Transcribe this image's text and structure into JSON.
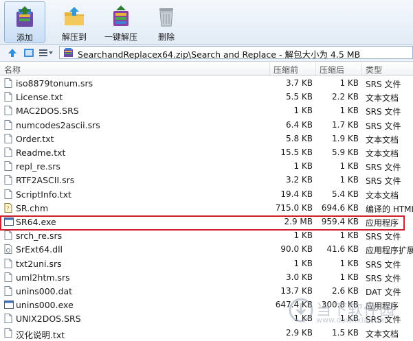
{
  "toolbar": {
    "add": "添加",
    "extract_to": "解压到",
    "one_click_extract": "一键解压",
    "delete": "删除"
  },
  "address": {
    "path": "SearchandReplacex64.zip\\Search and Replace - 解包大小为 4.5 MB"
  },
  "columns": {
    "name": "名称",
    "original_size": "压缩前",
    "compressed_size": "压缩后",
    "type": "类型"
  },
  "files": [
    {
      "name": "iso8879tonum.srs",
      "original": "3.7 KB",
      "compressed": "1 KB",
      "type": "SRS 文件"
    },
    {
      "name": "License.txt",
      "original": "5.5 KB",
      "compressed": "2.2 KB",
      "type": "文本文档"
    },
    {
      "name": "MAC2DOS.SRS",
      "original": "1 KB",
      "compressed": "1 KB",
      "type": "SRS 文件"
    },
    {
      "name": "numcodes2ascii.srs",
      "original": "6.4 KB",
      "compressed": "1.7 KB",
      "type": "SRS 文件"
    },
    {
      "name": "Order.txt",
      "original": "5.8 KB",
      "compressed": "1.9 KB",
      "type": "文本文档"
    },
    {
      "name": "Readme.txt",
      "original": "15.5 KB",
      "compressed": "5.9 KB",
      "type": "文本文档"
    },
    {
      "name": "repl_re.srs",
      "original": "1 KB",
      "compressed": "1 KB",
      "type": "SRS 文件"
    },
    {
      "name": "RTF2ASCII.srs",
      "original": "3.2 KB",
      "compressed": "1 KB",
      "type": "SRS 文件"
    },
    {
      "name": "ScriptInfo.txt",
      "original": "19.4 KB",
      "compressed": "5.4 KB",
      "type": "文本文档"
    },
    {
      "name": "SR.chm",
      "original": "715.0 KB",
      "compressed": "694.6 KB",
      "type": "编译的 HTML"
    },
    {
      "name": "SR64.exe",
      "original": "2.9 MB",
      "compressed": "959.4 KB",
      "type": "应用程序"
    },
    {
      "name": "srch_re.srs",
      "original": "1 KB",
      "compressed": "1 KB",
      "type": "SRS 文件"
    },
    {
      "name": "SrExt64.dll",
      "original": "90.0 KB",
      "compressed": "41.6 KB",
      "type": "应用程序扩展"
    },
    {
      "name": "txt2uni.srs",
      "original": "1 KB",
      "compressed": "1 KB",
      "type": "SRS 文件"
    },
    {
      "name": "uml2htm.srs",
      "original": "3.0 KB",
      "compressed": "1 KB",
      "type": "SRS 文件"
    },
    {
      "name": "unins000.dat",
      "original": "13.7 KB",
      "compressed": "2.6 KB",
      "type": "DAT 文件"
    },
    {
      "name": "unins000.exe",
      "original": "647.4 KB",
      "compressed": "300.8 KB",
      "type": "应用程序"
    },
    {
      "name": "UNIX2DOS.SRS",
      "original": "1 KB",
      "compressed": "1 KB",
      "type": "SRS 文件"
    },
    {
      "name": "汉化说明.txt",
      "original": "2.9 KB",
      "compressed": "1.5 KB",
      "type": "文本文档"
    }
  ],
  "icon_kinds": [
    "doc",
    "doc",
    "doc",
    "doc",
    "doc",
    "doc",
    "doc",
    "doc",
    "doc",
    "chm",
    "exe",
    "doc",
    "dll",
    "doc",
    "doc",
    "doc",
    "exe",
    "doc",
    "doc"
  ],
  "watermark": {
    "title": "当下软件园",
    "url": "www.downxia.com"
  },
  "colors": {
    "highlight_border": "#d21e2a",
    "toolbar_bg": "#e8eff8"
  }
}
